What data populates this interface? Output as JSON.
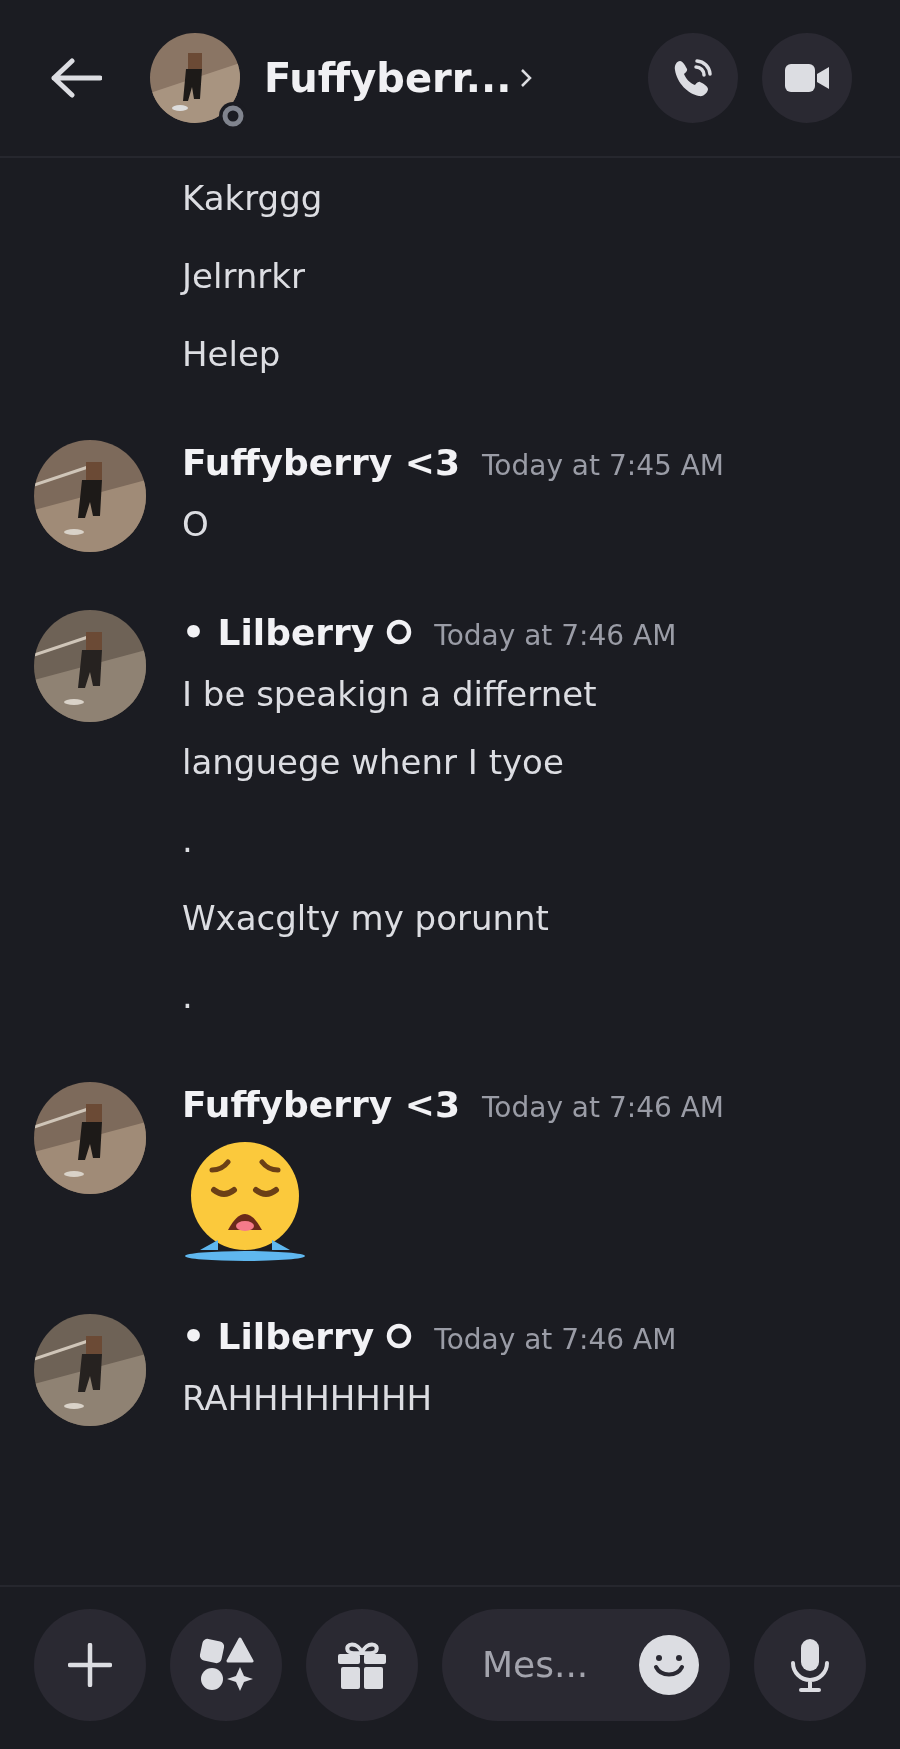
{
  "header": {
    "title": "Fuffyberr...",
    "offline": true
  },
  "messages": [
    {
      "continued": true,
      "lines": [
        {
          "kind": "text",
          "text": "Kakrggg"
        },
        {
          "kind": "text",
          "text": "Jelrnrkr"
        },
        {
          "kind": "text",
          "text": "Helep"
        }
      ]
    },
    {
      "continued": false,
      "author": "Fuffyberry <3",
      "decorated": false,
      "time": "Today at 7:45 AM",
      "lines": [
        {
          "kind": "text",
          "text": "O"
        }
      ]
    },
    {
      "continued": false,
      "author": "• Lilberry",
      "decorated": true,
      "time": "Today at 7:46 AM",
      "lines": [
        {
          "kind": "text",
          "text": "I be speakign a differnet languege whenr I tyoe"
        },
        {
          "kind": "text",
          "text": "."
        },
        {
          "kind": "text",
          "text": "Wxacglty my porunnt"
        },
        {
          "kind": "text",
          "text": "."
        }
      ]
    },
    {
      "continued": false,
      "author": "Fuffyberry <3",
      "decorated": false,
      "time": "Today at 7:46 AM",
      "lines": [
        {
          "kind": "emoji"
        }
      ]
    },
    {
      "continued": false,
      "author": "• Lilberry",
      "decorated": true,
      "time": "Today at 7:46 AM",
      "lines": [
        {
          "kind": "text",
          "text": "RAHHHHHHHH"
        }
      ]
    }
  ],
  "composer": {
    "placeholder": "Mes..."
  }
}
